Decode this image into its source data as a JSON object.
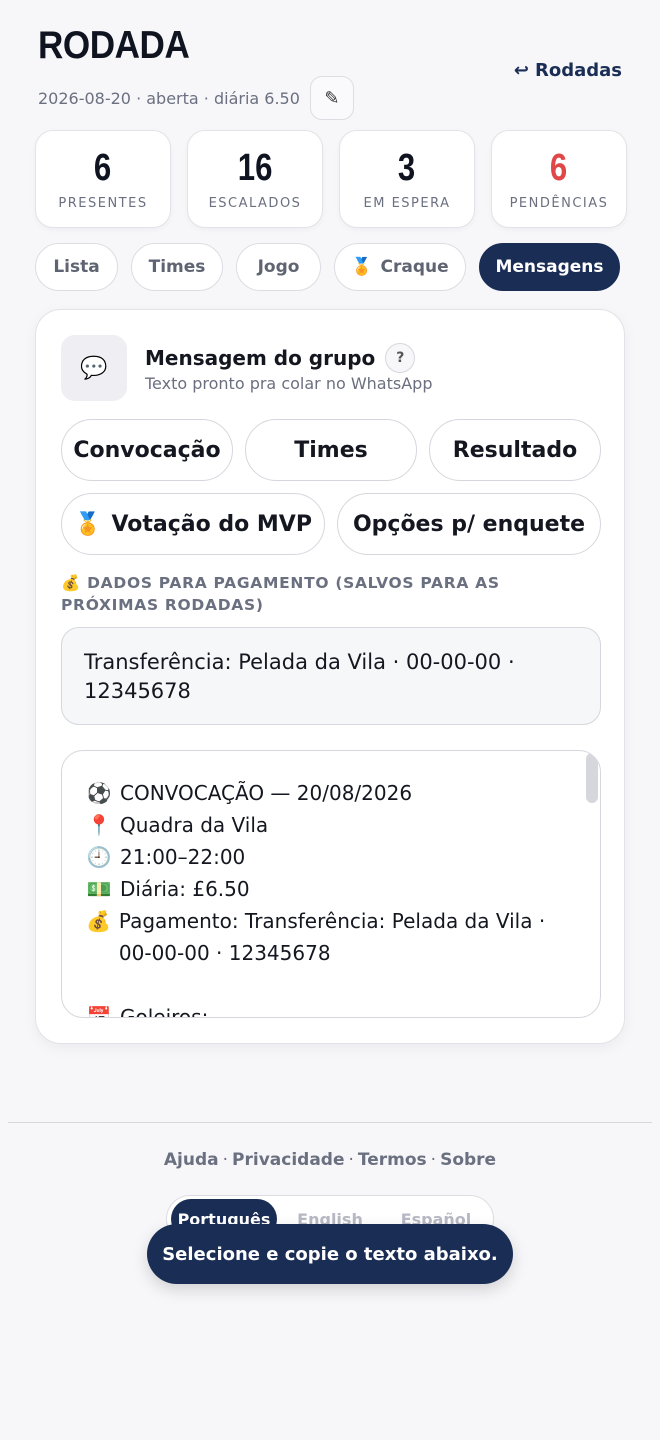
{
  "header": {
    "title": "RODADA",
    "back_label": "Rodadas",
    "meta": "2026-08-20 · aberta · diária 6.50"
  },
  "stats": [
    {
      "value": "6",
      "label": "PRESENTES"
    },
    {
      "value": "16",
      "label": "ESCALADOS"
    },
    {
      "value": "3",
      "label": "EM ESPERA"
    },
    {
      "value": "6",
      "label": "PENDÊNCIAS"
    }
  ],
  "tabs": [
    "Lista",
    "Times",
    "Jogo",
    "Craque",
    "Mensagens"
  ],
  "card": {
    "title": "Mensagem do grupo",
    "help": "?",
    "subtitle": "Texto pronto pra colar no WhatsApp",
    "buttons": [
      "Convocação",
      "Times",
      "Resultado",
      "Votação do MVP",
      "Opções p/ enquete"
    ],
    "payment_label": "DADOS PARA PAGAMENTO (SALVOS PARA AS PRÓXIMAS RODADAS)",
    "payment_value": "Transferência: Pelada da Vila · 00-00-00 · 12345678",
    "message_lines": [
      "CONVOCAÇÃO — 20/08/2026",
      "Quadra da Vila",
      "21:00–22:00",
      "Diária: £6.50",
      "Pagamento: Transferência: Pelada da Vila · 00-00-00 · 12345678",
      "",
      "Goleiros:"
    ]
  },
  "footer": {
    "links": [
      "Ajuda",
      "Privacidade",
      "Termos",
      "Sobre"
    ],
    "languages": [
      "Português",
      "English",
      "Español"
    ]
  },
  "toast": "Selecione e copie o texto abaixo."
}
